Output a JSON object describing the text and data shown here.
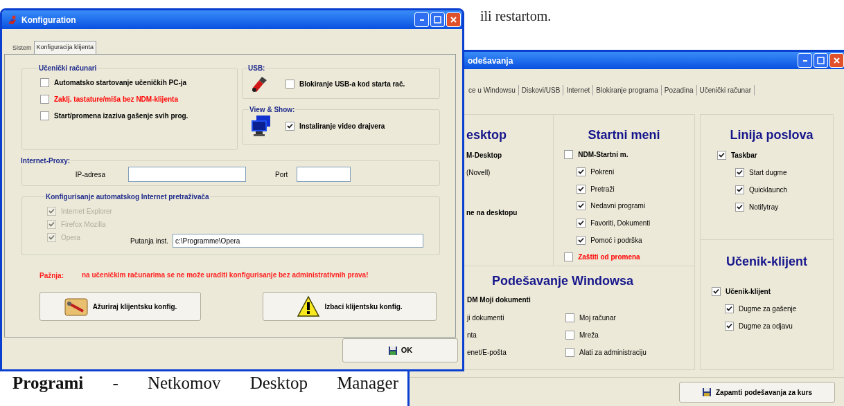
{
  "document": {
    "top_line": "ili restartom.",
    "paragraph": "**Programi** - Netkomov Desktop Manager"
  },
  "settings_window": {
    "title": "odešavanja",
    "tabs": [
      {
        "label": "ce u Windowsu",
        "selected": false
      },
      {
        "label": "Diskovi/USB",
        "selected": false
      },
      {
        "label": "Internet",
        "selected": false
      },
      {
        "label": "Blokiranje programa",
        "selected": false
      },
      {
        "label": "Pozadina",
        "selected": false
      },
      {
        "label": "Učenički računar",
        "selected": false
      }
    ],
    "desktop": {
      "heading": "esktop",
      "items": [
        {
          "kind": "bold",
          "label": "M-Desktop"
        },
        {
          "kind": "plain",
          "label": "(Novell)"
        },
        {
          "kind": "bold",
          "label": "ne na desktopu"
        }
      ]
    },
    "start_menu": {
      "heading": "Startni meni",
      "options": [
        {
          "label": "NDM-Startni m.",
          "checked": false,
          "color": "#000000",
          "children": [
            {
              "label": "Pokreni",
              "checked": true
            },
            {
              "label": "Pretraži",
              "checked": true
            },
            {
              "label": "Nedavni programi",
              "checked": true
            },
            {
              "label": "Favoriti, Dokumenti",
              "checked": true
            },
            {
              "label": "Pomoć i podrška",
              "checked": true
            }
          ]
        },
        {
          "label": "Zaštiti od promena",
          "checked": false,
          "color": "#ff0000"
        }
      ]
    },
    "windows_settings": {
      "heading": "Podešavanje Windowsa",
      "group_label": "DM Moji dokumenti",
      "left_items": [
        "ji dokumenti",
        "nta",
        "enet/E-pošta"
      ],
      "options": [
        {
          "label": "Moj računar",
          "checked": false
        },
        {
          "label": "Mreža",
          "checked": false
        },
        {
          "label": "Alati za administraciju",
          "checked": false
        }
      ]
    },
    "taskbar": {
      "heading": "Linija poslova",
      "options": [
        {
          "label": "Taskbar",
          "checked": true,
          "color": "#000000",
          "children": [
            {
              "label": "Start dugme",
              "checked": true
            },
            {
              "label": "Quicklaunch",
              "checked": true
            },
            {
              "label": "Notifytray",
              "checked": true
            }
          ]
        }
      ]
    },
    "student_client": {
      "heading": "Učenik-klijent",
      "options": [
        {
          "label": "Učenik-klijent",
          "checked": true,
          "color": "#000000",
          "children": [
            {
              "label": "Dugme za gašenje",
              "checked": true
            },
            {
              "label": "Dugme za odjavu",
              "checked": true
            }
          ]
        }
      ]
    },
    "save_button": "Zapamti podešavanja za kurs"
  },
  "config_window": {
    "title": "Konfiguration",
    "tabs": [
      {
        "label": "Sistem",
        "selected": false
      },
      {
        "label": "Konfiguracija klijenta",
        "selected": true
      }
    ],
    "student_pcs": {
      "legend": "Učenički računari",
      "options": [
        {
          "label": "Automatsko startovanje učeničkih PC-ja",
          "checked": false,
          "color": "#000000"
        },
        {
          "label": "Zaklj. tastature/miša bez NDM-klijenta",
          "checked": false,
          "color": "#ff0000"
        },
        {
          "label": "Start/promena izaziva gašenje svih prog.",
          "checked": false,
          "color": "#000000"
        }
      ]
    },
    "usb": {
      "legend": "USB:",
      "option": {
        "label": "Blokiranje USB-a kod starta rač.",
        "checked": false
      }
    },
    "view_show": {
      "legend": "View & Show:",
      "option": {
        "label": "Instaliranje video drajvera",
        "checked": true
      }
    },
    "proxy": {
      "legend": "Internet-Proxy:",
      "ip_label": "IP-adresa",
      "port_label": "Port"
    },
    "browsers": {
      "legend": "Konfigurisanje automatskog Internet pretraživača",
      "options": [
        {
          "label": "Internet Explorer",
          "checked": true,
          "disabled": true
        },
        {
          "label": "Firefox Mozilla",
          "checked": true,
          "disabled": true
        },
        {
          "label": "Opera",
          "checked": true,
          "disabled": true
        }
      ],
      "path_label": "Putanja inst.",
      "path_value": "c:\\Programme\\Opera"
    },
    "warning": {
      "label": "Pažnja:",
      "text": "na učeničkim računarima se ne može uraditi konfigurisanje bez administrativnih prava!"
    },
    "buttons": [
      {
        "kind": "update",
        "label": "Ažuriraj klijentsku konfig."
      },
      {
        "kind": "warning",
        "label": "Izbaci klijentsku konfig."
      }
    ],
    "ok_button": "OK"
  }
}
